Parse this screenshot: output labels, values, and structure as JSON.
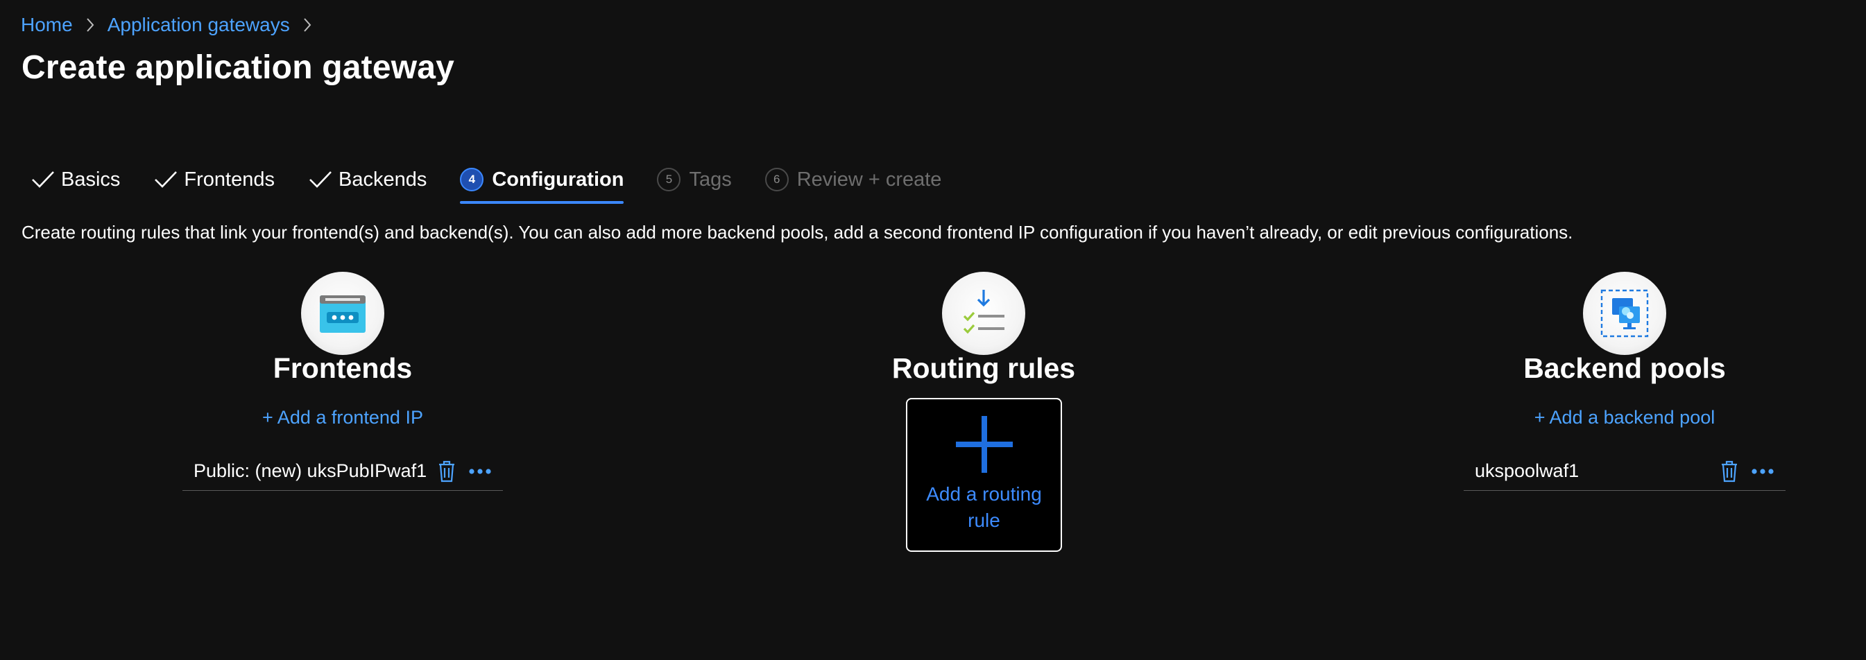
{
  "breadcrumb": {
    "items": [
      "Home",
      "Application gateways"
    ]
  },
  "page": {
    "title": "Create application gateway",
    "description": "Create routing rules that link your frontend(s) and backend(s). You can also add more backend pools, add a second frontend IP configuration if you haven’t already, or edit previous configurations."
  },
  "tabs": [
    {
      "label": "Basics",
      "state": "completed"
    },
    {
      "label": "Frontends",
      "state": "completed"
    },
    {
      "label": "Backends",
      "state": "completed"
    },
    {
      "label": "Configuration",
      "state": "current",
      "step": "4"
    },
    {
      "label": "Tags",
      "state": "future",
      "step": "5"
    },
    {
      "label": "Review + create",
      "state": "future",
      "step": "6"
    }
  ],
  "frontends": {
    "title": "Frontends",
    "add_label": "+ Add a frontend IP",
    "items": [
      "Public: (new) uksPubIPwaf1"
    ],
    "icon": "frontend-window-icon"
  },
  "routing": {
    "title": "Routing rules",
    "add_label": "Add a routing rule",
    "icon": "routing-checklist-icon"
  },
  "backends": {
    "title": "Backend pools",
    "add_label": "+ Add a backend pool",
    "items": [
      "ukspoolwaf1"
    ],
    "icon": "backend-pool-icon"
  },
  "colors": {
    "background": "#111111",
    "link": "#4da3ff",
    "accent": "#3b88ff",
    "disabled": "#6e6e6e"
  }
}
